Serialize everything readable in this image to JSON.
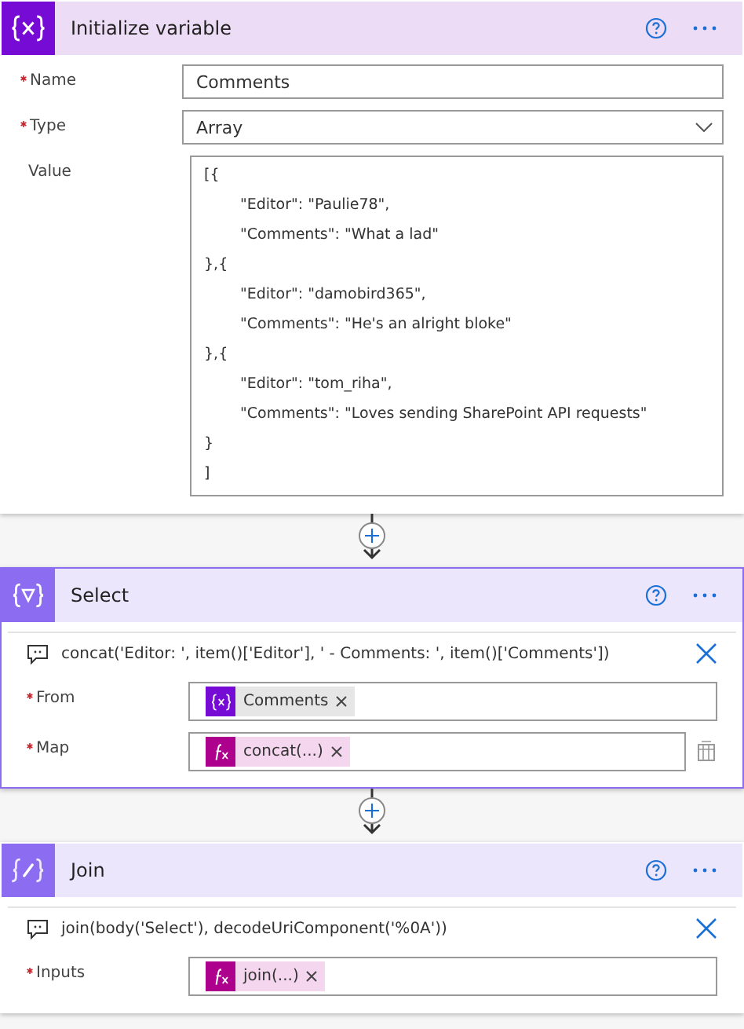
{
  "cards": [
    {
      "kind": "variable",
      "title": "Initialize variable",
      "selected": false,
      "fields": [
        {
          "label": "Name",
          "required": true,
          "kind": "text",
          "value": "Comments"
        },
        {
          "label": "Type",
          "required": true,
          "kind": "dropdown",
          "value": "Array"
        },
        {
          "label": "Value",
          "required": false,
          "kind": "multiline",
          "lines": [
            {
              "text": "[{",
              "indented": false
            },
            {
              "text": "\"Editor\": \"Paulie78\",",
              "indented": true
            },
            {
              "text": "\"Comments\": \"What a lad\"",
              "indented": true
            },
            {
              "text": "},{",
              "indented": false
            },
            {
              "text": "\"Editor\": \"damobird365\",",
              "indented": true
            },
            {
              "text": "\"Comments\": \"He's an alright bloke\"",
              "indented": true
            },
            {
              "text": "},{",
              "indented": false
            },
            {
              "text": "\"Editor\": \"tom_riha\",",
              "indented": true
            },
            {
              "text": "\"Comments\": \"Loves sending SharePoint API requests\"",
              "indented": true
            },
            {
              "text": "}",
              "indented": false
            },
            {
              "text": "]",
              "indented": false
            }
          ]
        }
      ]
    },
    {
      "kind": "select",
      "title": "Select",
      "selected": true,
      "expression": "concat('Editor: ', item()['Editor'], ' - Comments: ', item()['Comments'])",
      "fields": [
        {
          "label": "From",
          "required": true,
          "kind": "tokens",
          "side_icon": false,
          "tokens": [
            {
              "kind": "variable",
              "label": "Comments"
            }
          ]
        },
        {
          "label": "Map",
          "required": true,
          "kind": "tokens",
          "side_icon": true,
          "tokens": [
            {
              "kind": "expression",
              "label": "concat(...)"
            }
          ]
        }
      ]
    },
    {
      "kind": "join",
      "title": "Join",
      "selected": false,
      "expression": "join(body('Select'), decodeUriComponent('%0A'))",
      "fields": [
        {
          "label": "Inputs",
          "required": true,
          "kind": "tokens",
          "side_icon": false,
          "tokens": [
            {
              "kind": "expression",
              "label": "join(...)"
            }
          ]
        }
      ]
    }
  ]
}
